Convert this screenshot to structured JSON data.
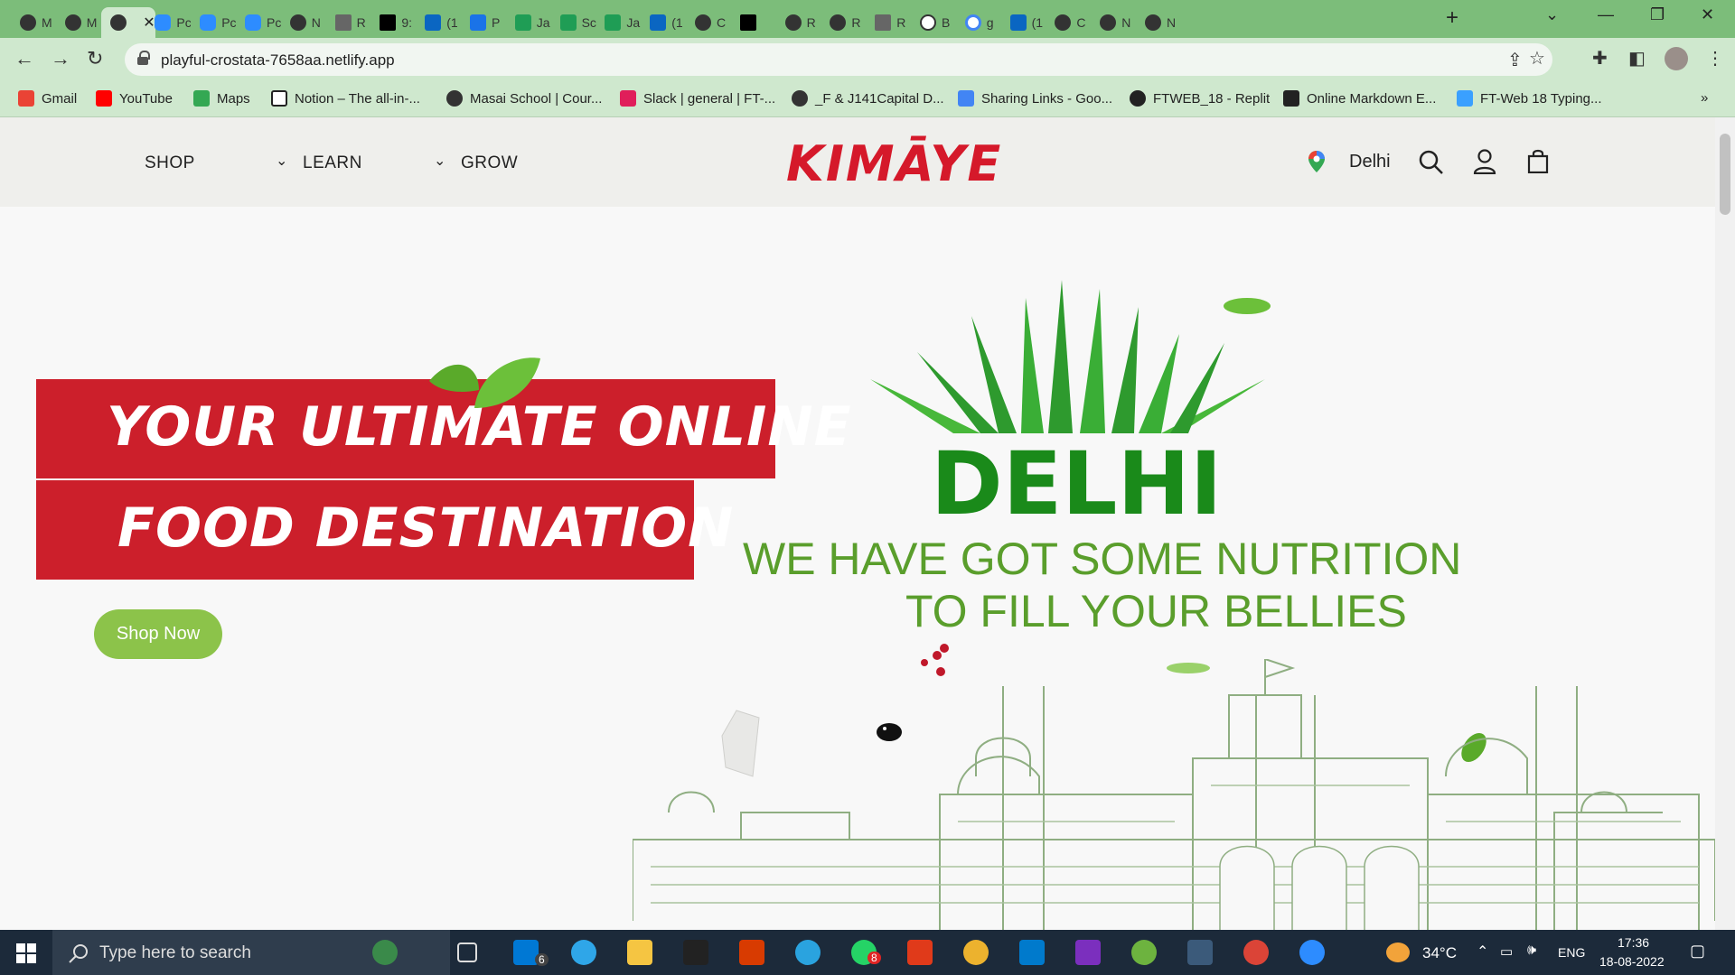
{
  "browser": {
    "tabs": [
      {
        "label": "M",
        "icon": "globe-icon"
      },
      {
        "label": "M",
        "icon": "globe-icon"
      },
      {
        "label": "",
        "icon": "globe-icon",
        "active": true
      },
      {
        "label": "Pc",
        "icon": "zoom-icon"
      },
      {
        "label": "Pc",
        "icon": "zoom-icon"
      },
      {
        "label": "Pc",
        "icon": "zoom-icon"
      },
      {
        "label": "N",
        "icon": "netlify-icon"
      },
      {
        "label": "R",
        "icon": "face-icon"
      },
      {
        "label": "9:",
        "icon": "cursor-icon"
      },
      {
        "label": "(1",
        "icon": "linkedin-icon"
      },
      {
        "label": "P",
        "icon": "blue-icon"
      },
      {
        "label": "Ja",
        "icon": "green-icon"
      },
      {
        "label": "Sc",
        "icon": "vue-icon"
      },
      {
        "label": "Ja",
        "icon": "green-icon"
      },
      {
        "label": "(1",
        "icon": "linkedin-icon"
      },
      {
        "label": "C",
        "icon": "globe-icon"
      },
      {
        "label": "",
        "icon": "dev-icon"
      },
      {
        "label": "R",
        "icon": "globe-icon"
      },
      {
        "label": "R",
        "icon": "globe-icon"
      },
      {
        "label": "R",
        "icon": "face-icon"
      },
      {
        "label": "B",
        "icon": "smile-icon"
      },
      {
        "label": "g",
        "icon": "google-icon"
      },
      {
        "label": "(1",
        "icon": "linkedin-icon"
      },
      {
        "label": "C",
        "icon": "globe-icon"
      },
      {
        "label": "N",
        "icon": "netlify-icon"
      },
      {
        "label": "N",
        "icon": "netlify-icon"
      }
    ],
    "tab_close": "✕",
    "new_tab": "+",
    "url": "playful-crostata-7658aa.netlify.app",
    "bookmarks": [
      {
        "label": "Gmail",
        "color": "#ea4335"
      },
      {
        "label": "YouTube",
        "color": "#ff0000"
      },
      {
        "label": "Maps",
        "color": "#34a853"
      },
      {
        "label": "Notion – The all-in-...",
        "color": "#222222"
      },
      {
        "label": "Masai School | Cour...",
        "color": "#333333"
      },
      {
        "label": "Slack | general | FT-...",
        "color": "#e01e5a"
      },
      {
        "label": "_F & J141Capital D...",
        "color": "#333333"
      },
      {
        "label": "Sharing Links - Goo...",
        "color": "#4285f4"
      },
      {
        "label": "FTWEB_18 - Replit",
        "color": "#222222"
      },
      {
        "label": "Online Markdown E...",
        "color": "#222222"
      },
      {
        "label": "FT-Web 18 Typing...",
        "color": "#3aa0ff"
      }
    ],
    "bookmarks_more": "»"
  },
  "site": {
    "nav": {
      "shop": "SHOP",
      "learn": "LEARN",
      "grow": "GROW",
      "chevron": "⌄"
    },
    "logo_text": "KIMĀYE",
    "city": "Delhi",
    "hero": {
      "line1": "YOUR ULTIMATE ONLINE",
      "line2": "FOOD DESTINATION",
      "cta": "Shop Now",
      "city_title": "DELHI",
      "tagline1": "WE HAVE GOT SOME NUTRITION",
      "tagline2": "TO FILL YOUR BELLIES"
    },
    "colors": {
      "brand_red": "#cc1f2b",
      "cta_green": "#8cc34a",
      "title_green": "#1a8a1a",
      "tagline_green": "#5a9e2c"
    }
  },
  "taskbar": {
    "search_placeholder": "Type here to search",
    "mail_badge": "6",
    "whatsapp_badge": "8",
    "temperature": "34°C",
    "language": "ENG",
    "time": "17:36",
    "date": "18-08-2022"
  }
}
